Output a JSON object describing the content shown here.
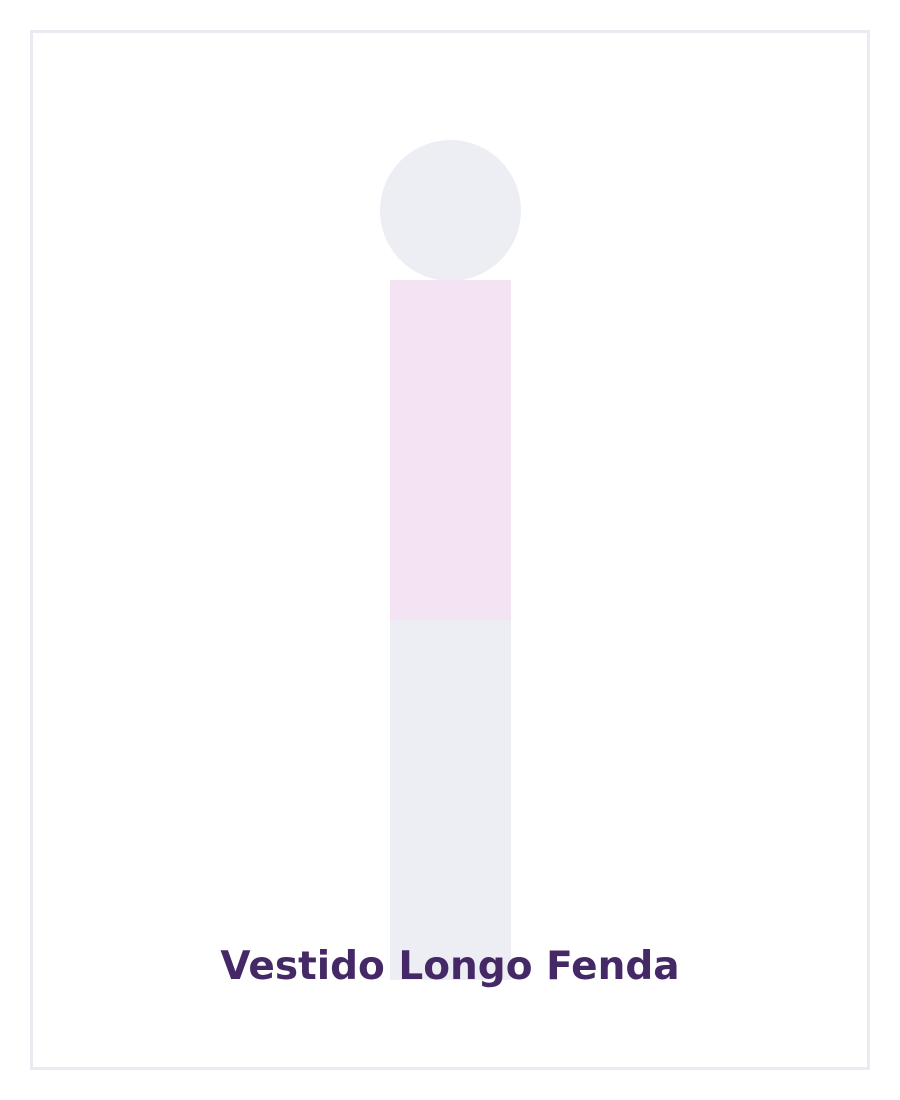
{
  "product": {
    "name": "Vestido Longo Fenda"
  },
  "illustration": {
    "icon": "dress-mannequin-icon",
    "colors": {
      "head": "#edeef3",
      "bodice": "#f3e3f3",
      "skirt": "#edeef3"
    }
  },
  "colors": {
    "frame_border": "#ebeaf3",
    "title_text": "#452966",
    "background": "#ffffff"
  }
}
